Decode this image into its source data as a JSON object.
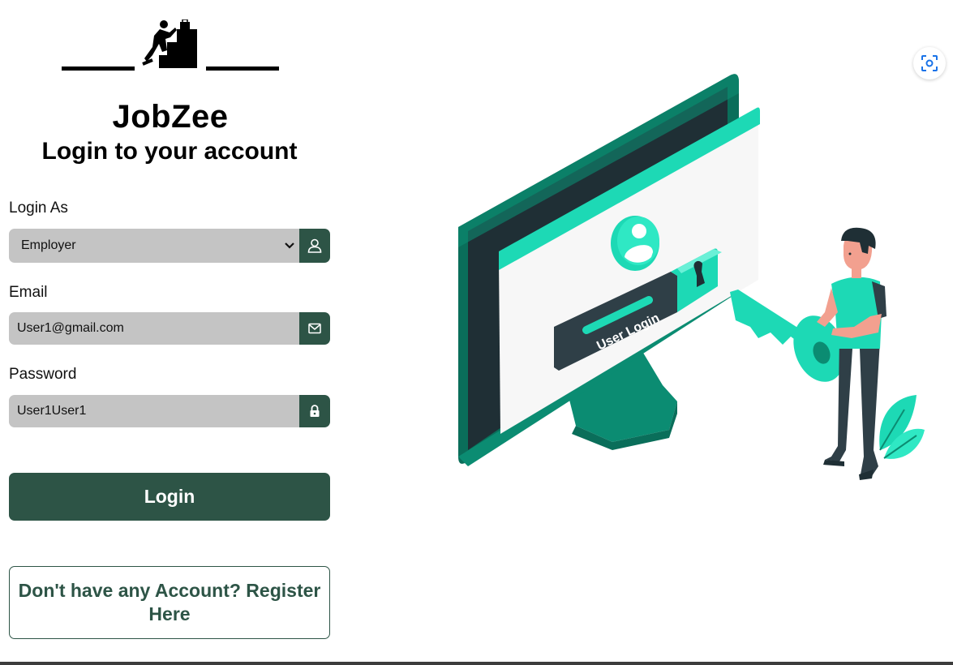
{
  "brand": {
    "name": "JobZee"
  },
  "page": {
    "heading": "Login to your account"
  },
  "form": {
    "role_label": "Login As",
    "role_value": "Employer",
    "email_label": "Email",
    "email_value": "User1@gmail.com",
    "password_label": "Password",
    "password_value": "User1User1",
    "login_label": "Login",
    "register_label": "Don't have any Account? Register Here"
  },
  "illustration": {
    "screen_text": "User Login"
  },
  "icons": [
    "user-icon",
    "mail-icon",
    "lock-icon",
    "chevron-down-icon",
    "lens-scan-icon"
  ],
  "colors": {
    "primary": "#2d5446",
    "input_bg": "#c4c4c4",
    "accent": "#1dd9b5",
    "teal_dark": "#0b8c72"
  }
}
